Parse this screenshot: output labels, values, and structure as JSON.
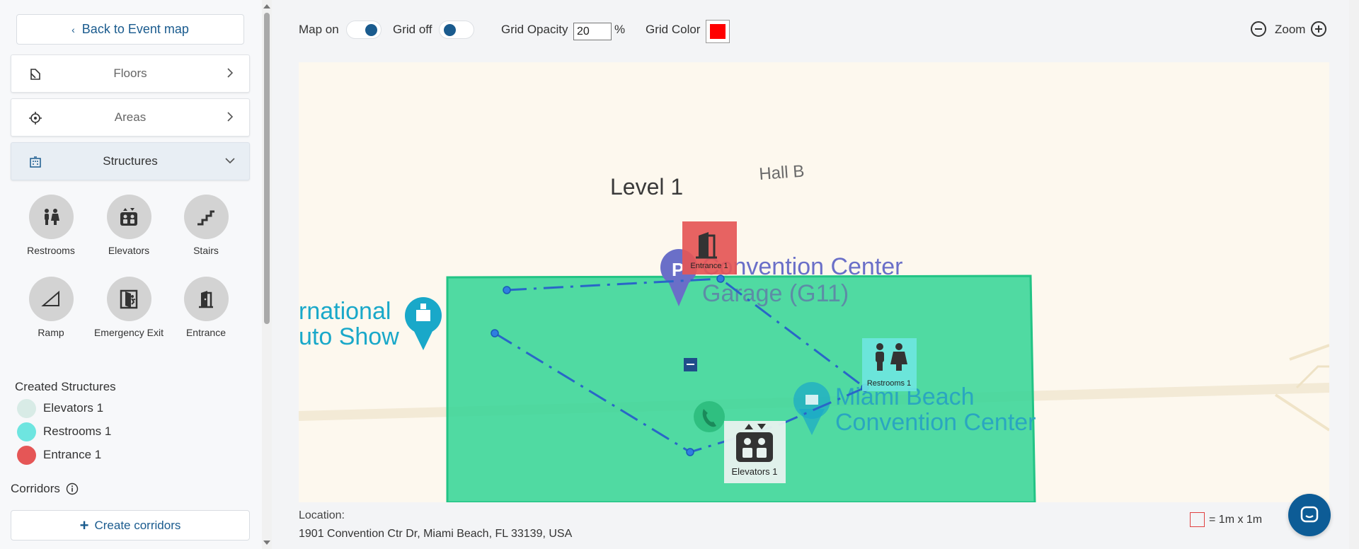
{
  "sidebar": {
    "back_label": "Back to Event map",
    "sections": {
      "floors": "Floors",
      "areas": "Areas",
      "structures": "Structures"
    },
    "structure_types": [
      {
        "label": "Restrooms",
        "icon": "restroom-icon"
      },
      {
        "label": "Elevators",
        "icon": "elevator-icon"
      },
      {
        "label": "Stairs",
        "icon": "stairs-icon"
      },
      {
        "label": "Ramp",
        "icon": "ramp-icon"
      },
      {
        "label": "Emergency Exit",
        "icon": "emergency-exit-icon"
      },
      {
        "label": "Entrance",
        "icon": "entrance-icon"
      }
    ],
    "created_title": "Created Structures",
    "created": [
      {
        "label": "Elevators 1",
        "color": "#d8ebe6"
      },
      {
        "label": "Restrooms 1",
        "color": "#6ee5e0"
      },
      {
        "label": "Entrance 1",
        "color": "#e55656"
      }
    ],
    "corridors_title": "Corridors",
    "create_corridors_label": "Create corridors"
  },
  "toolbar": {
    "map_label": "Map on",
    "grid_label": "Grid off",
    "opacity_label": "Grid Opacity",
    "opacity_value": "20",
    "opacity_unit": "%",
    "grid_color_label": "Grid Color",
    "grid_color": "#ff0000",
    "zoom_label": "Zoom"
  },
  "map": {
    "labels": {
      "level": "Level 1",
      "hall": "Hall B",
      "garage_line1": "Convention Center",
      "garage_line2": "Garage (G11)",
      "show_line1": "rnational",
      "show_line2": "uto Show",
      "center_line1": "Miami Beach",
      "center_line2": "Convention Center"
    },
    "markers": {
      "entrance": "Entrance 1",
      "restrooms": "Restrooms 1",
      "elevators": "Elevators 1"
    },
    "area_color": "#3dd699"
  },
  "footer": {
    "location_label": "Location:",
    "location_value": "1901 Convention Ctr Dr, Miami Beach, FL 33139, USA",
    "scale_label": "= 1m x 1m"
  }
}
